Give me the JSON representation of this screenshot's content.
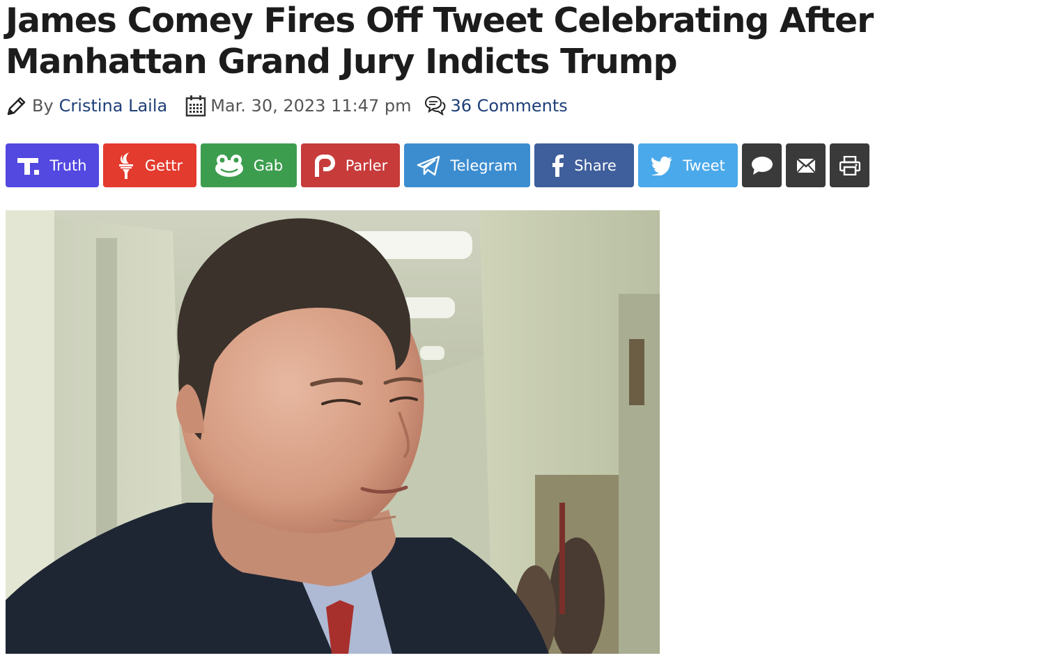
{
  "article": {
    "headline": "James Comey Fires Off Tweet Celebrating After Manhattan Grand Jury Indicts Trump",
    "byline_prefix": "By",
    "author": "Cristina Laila",
    "date": "Mar. 30, 2023 11:47 pm",
    "comments_link": "36 Comments"
  },
  "share_buttons": [
    {
      "label": "Truth",
      "icon": "truth-social-icon",
      "color": "#5348e0"
    },
    {
      "label": "Gettr",
      "icon": "gettr-icon",
      "color": "#e33b2e"
    },
    {
      "label": "Gab",
      "icon": "gab-frog-icon",
      "color": "#3d9d4f"
    },
    {
      "label": "Parler",
      "icon": "parler-icon",
      "color": "#c73b3b"
    },
    {
      "label": "Telegram",
      "icon": "telegram-plane-icon",
      "color": "#3c8dd0"
    },
    {
      "label": "Share",
      "icon": "facebook-icon",
      "color": "#3f5e9c"
    },
    {
      "label": "Tweet",
      "icon": "twitter-bird-icon",
      "color": "#4aa9ea"
    },
    {
      "label": "",
      "icon": "comment-bubble-icon",
      "color": "#3a3a3a"
    },
    {
      "label": "",
      "icon": "email-icon",
      "color": "#3a3a3a"
    },
    {
      "label": "",
      "icon": "print-icon",
      "color": "#3a3a3a"
    }
  ],
  "icons": {
    "author": "pencil-icon",
    "date": "calendar-icon",
    "comments": "comments-icon"
  }
}
